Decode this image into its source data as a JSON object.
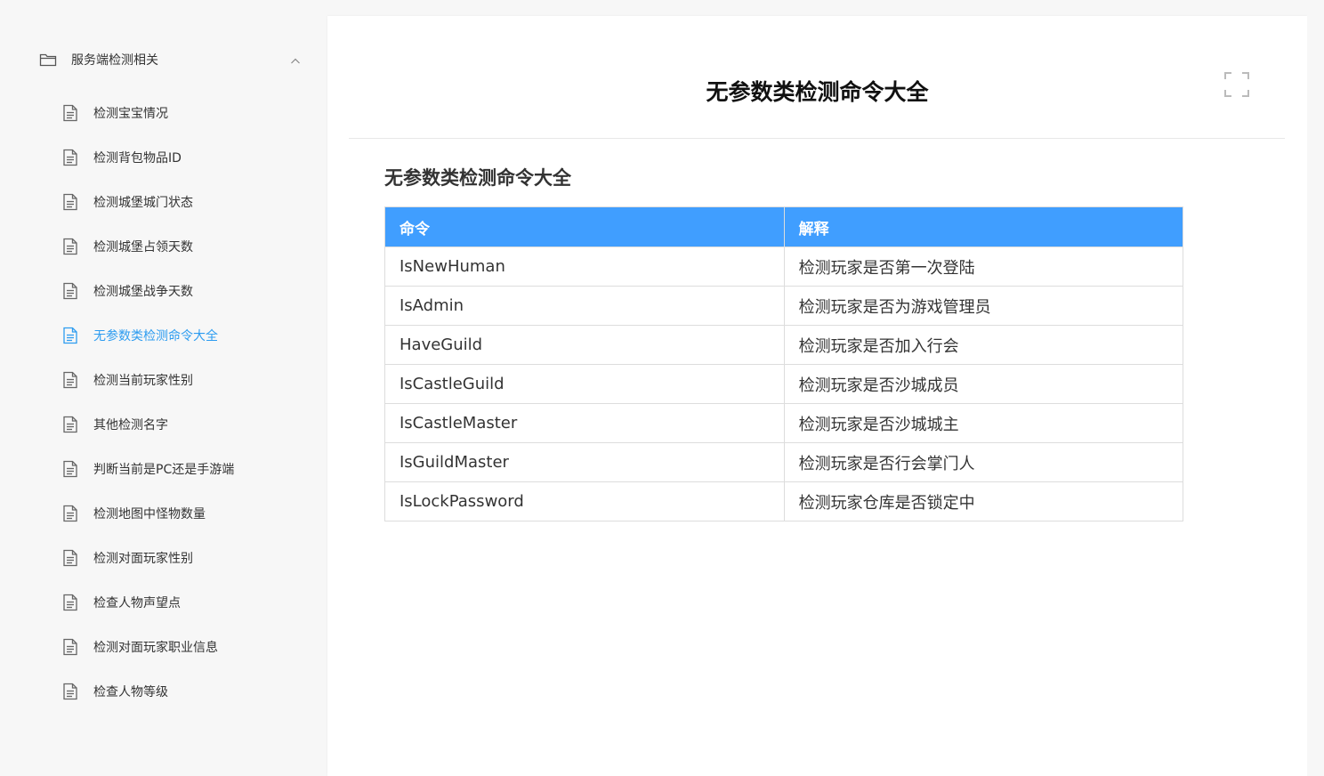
{
  "sidebar": {
    "folder": {
      "label": "服务端检测相关",
      "icon": "folder-icon",
      "expanded": true
    },
    "items": [
      {
        "label": "检测宝宝情况",
        "active": false
      },
      {
        "label": "检测背包物品ID",
        "active": false
      },
      {
        "label": "检测城堡城门状态",
        "active": false
      },
      {
        "label": "检测城堡占领天数",
        "active": false
      },
      {
        "label": "检测城堡战争天数",
        "active": false
      },
      {
        "label": "无参数类检测命令大全",
        "active": true
      },
      {
        "label": "检测当前玩家性别",
        "active": false
      },
      {
        "label": "其他检测名字",
        "active": false
      },
      {
        "label": "判断当前是PC还是手游端",
        "active": false
      },
      {
        "label": "检测地图中怪物数量",
        "active": false
      },
      {
        "label": "检测对面玩家性别",
        "active": false
      },
      {
        "label": "检查人物声望点",
        "active": false
      },
      {
        "label": "检测对面玩家职业信息",
        "active": false
      },
      {
        "label": "检查人物等级",
        "active": false
      }
    ]
  },
  "main": {
    "title": "无参数类检测命令大全",
    "section_heading": "无参数类检测命令大全",
    "table": {
      "headers": [
        "命令",
        "解释"
      ],
      "rows": [
        [
          "IsNewHuman",
          "检测玩家是否第一次登陆"
        ],
        [
          "IsAdmin",
          "检测玩家是否为游戏管理员"
        ],
        [
          "HaveGuild",
          "检测玩家是否加入行会"
        ],
        [
          "IsCastleGuild",
          "检测玩家是否沙城成员"
        ],
        [
          "IsCastleMaster",
          "检测玩家是否沙城城主"
        ],
        [
          "IsGuildMaster",
          "检测玩家是否行会掌门人"
        ],
        [
          "IsLockPassword",
          "检测玩家仓库是否锁定中"
        ]
      ]
    }
  },
  "colors": {
    "accent": "#2d9cf0",
    "table_header": "#409eff",
    "page_bg": "#f7f7f7"
  }
}
